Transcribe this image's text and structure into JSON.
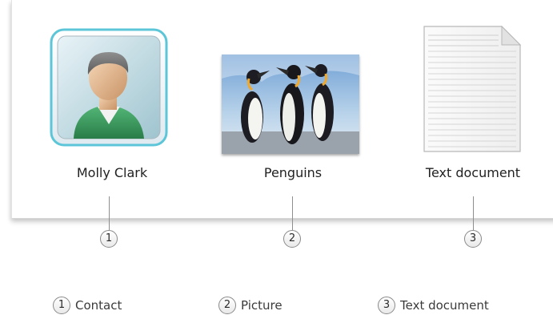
{
  "items": [
    {
      "label": "Molly Clark",
      "number": "1",
      "icon": "contact-icon"
    },
    {
      "label": "Penguins",
      "number": "2",
      "icon": "picture-thumbnail"
    },
    {
      "label": "Text document",
      "number": "3",
      "icon": "text-document-icon"
    }
  ],
  "legend": [
    {
      "number": "1",
      "text": "Contact"
    },
    {
      "number": "2",
      "text": "Picture"
    },
    {
      "number": "3",
      "text": "Text document"
    }
  ],
  "colors": {
    "panel_background": "#ffffff",
    "callout_border": "#8a8a8a",
    "leader_line": "#8e8e8e",
    "contact_frame_accent": "#5cc6d8",
    "contact_shirt": "#3c9a5a",
    "sky": "#9ec4e6"
  }
}
